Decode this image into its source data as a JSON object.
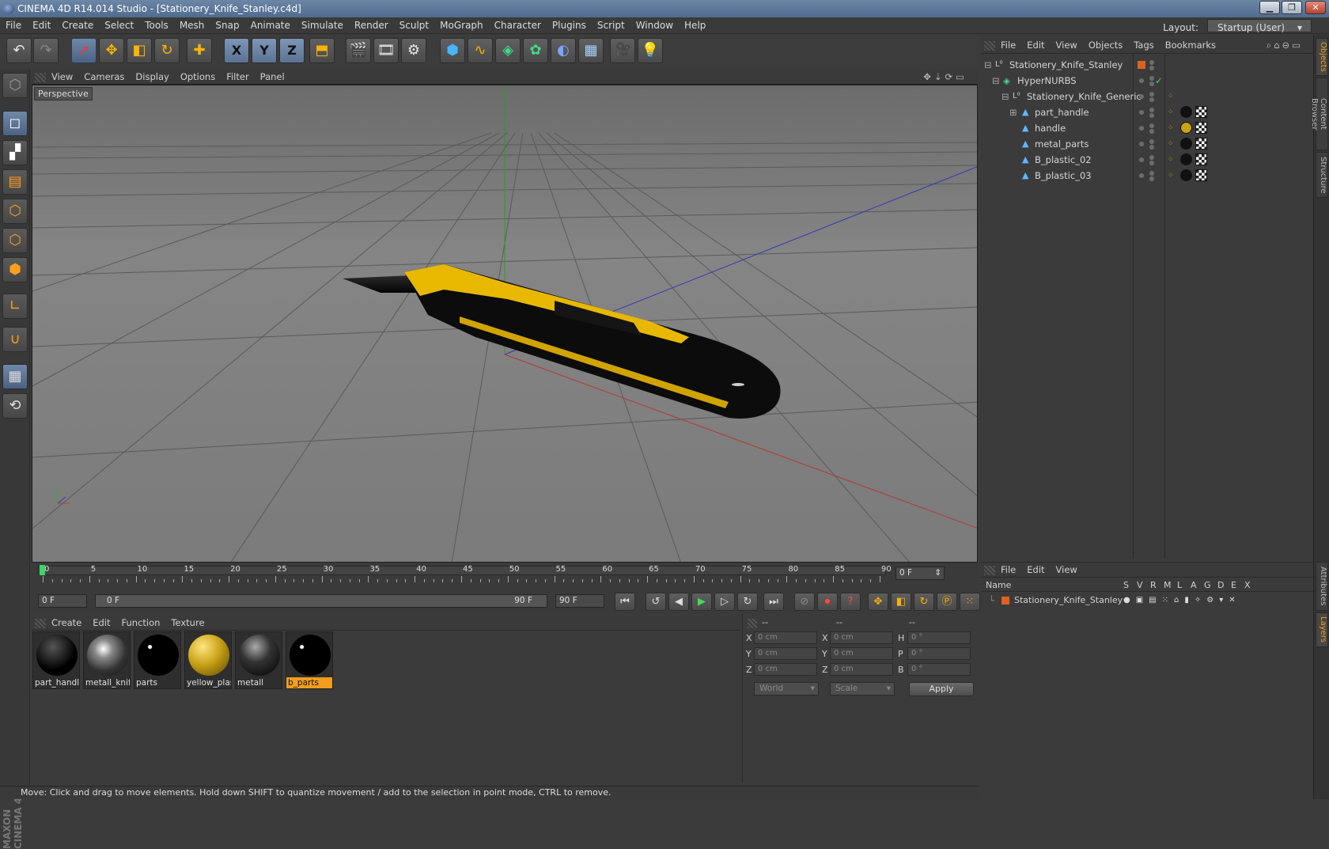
{
  "title": "CINEMA 4D R14.014 Studio - [Stationery_Knife_Stanley.c4d]",
  "menu": [
    "File",
    "Edit",
    "Create",
    "Select",
    "Tools",
    "Mesh",
    "Snap",
    "Animate",
    "Simulate",
    "Render",
    "Sculpt",
    "MoGraph",
    "Character",
    "Plugins",
    "Script",
    "Window",
    "Help"
  ],
  "layout": {
    "label": "Layout:",
    "value": "Startup (User)"
  },
  "toolbar_icons": [
    "undo-icon",
    "redo-icon",
    "live-selection-icon",
    "move-icon",
    "scale-icon",
    "rotate-icon",
    "create-object-icon",
    "x-axis-icon",
    "y-axis-icon",
    "z-axis-icon",
    "coordinate-system-icon",
    "render-view-icon",
    "render-picture-viewer-icon",
    "edit-render-settings-icon",
    "cube-icon",
    "spline-icon",
    "nurbs-icon",
    "array-icon",
    "deformer-icon",
    "floor-icon",
    "camera-icon",
    "light-icon"
  ],
  "axis_labels": {
    "x": "X",
    "y": "Y",
    "z": "Z"
  },
  "viewport": {
    "menu": [
      "View",
      "Cameras",
      "Display",
      "Options",
      "Filter",
      "Panel"
    ],
    "label": "Perspective"
  },
  "timeline": {
    "ticks": [
      "0",
      "5",
      "10",
      "15",
      "20",
      "25",
      "30",
      "35",
      "40",
      "45",
      "50",
      "55",
      "60",
      "65",
      "70",
      "75",
      "80",
      "85",
      "90"
    ],
    "current_frame_readout": "0 F",
    "start_field": "0 F",
    "slider_left": "0 F",
    "slider_right": "90 F",
    "end_field": "90 F"
  },
  "materials_menu": [
    "Create",
    "Edit",
    "Function",
    "Texture"
  ],
  "materials": [
    {
      "label": "part_handl",
      "kind": "black"
    },
    {
      "label": "metall_knif",
      "kind": "chrome"
    },
    {
      "label": "parts",
      "kind": "black-dot"
    },
    {
      "label": "yellow_plas",
      "kind": "yellow"
    },
    {
      "label": "metall",
      "kind": "dark-chrome"
    },
    {
      "label": "b_parts",
      "kind": "black-dot",
      "selected": true
    }
  ],
  "coords": {
    "headers": [
      "--",
      "--",
      "--"
    ],
    "rows": [
      {
        "a": "X",
        "av": "0 cm",
        "b": "X",
        "bv": "0 cm",
        "c": "H",
        "cv": "0 °"
      },
      {
        "a": "Y",
        "av": "0 cm",
        "b": "Y",
        "bv": "0 cm",
        "c": "P",
        "cv": "0 °"
      },
      {
        "a": "Z",
        "av": "0 cm",
        "b": "Z",
        "bv": "0 cm",
        "c": "B",
        "cv": "0 °"
      }
    ],
    "space": "World",
    "mode": "Scale",
    "apply": "Apply"
  },
  "objects_menu": [
    "File",
    "Edit",
    "View",
    "Objects",
    "Tags",
    "Bookmarks"
  ],
  "objects": [
    {
      "name": "Stationery_Knife_Stanley",
      "depth": 0,
      "type": "null"
    },
    {
      "name": "HyperNURBS",
      "depth": 1,
      "type": "nurbs",
      "check": "✓"
    },
    {
      "name": "Stationery_Knife_Generic",
      "depth": 2,
      "type": "null"
    },
    {
      "name": "part_handle",
      "depth": 3,
      "type": "poly",
      "tag": "#111"
    },
    {
      "name": "handle",
      "depth": 3,
      "type": "poly",
      "tag": "#c9a217"
    },
    {
      "name": "metal_parts",
      "depth": 3,
      "type": "poly",
      "tag": "#111"
    },
    {
      "name": "B_plastic_02",
      "depth": 3,
      "type": "poly",
      "tag": "#111"
    },
    {
      "name": "B_plastic_03",
      "depth": 3,
      "type": "poly",
      "tag": "#111"
    }
  ],
  "layers_menu": [
    "File",
    "Edit",
    "View"
  ],
  "layers": {
    "columns": [
      "Name",
      "S",
      "V",
      "R",
      "M",
      "L",
      "A",
      "G",
      "D",
      "E",
      "X"
    ],
    "rows": [
      {
        "name": "Stationery_Knife_Stanley",
        "color": "#e06020"
      }
    ]
  },
  "right_tabs": [
    "Objects",
    "Content Browser",
    "Structure",
    "Attributes",
    "Layers"
  ],
  "brand": "MAXON CINEMA 4D",
  "status": "Move: Click and drag to move elements. Hold down SHIFT to quantize movement / add to the selection in point mode, CTRL to remove.",
  "colors": {
    "accent": "#f29d1c",
    "selection": "#5b7394",
    "knife_yellow": "#e8b800"
  }
}
